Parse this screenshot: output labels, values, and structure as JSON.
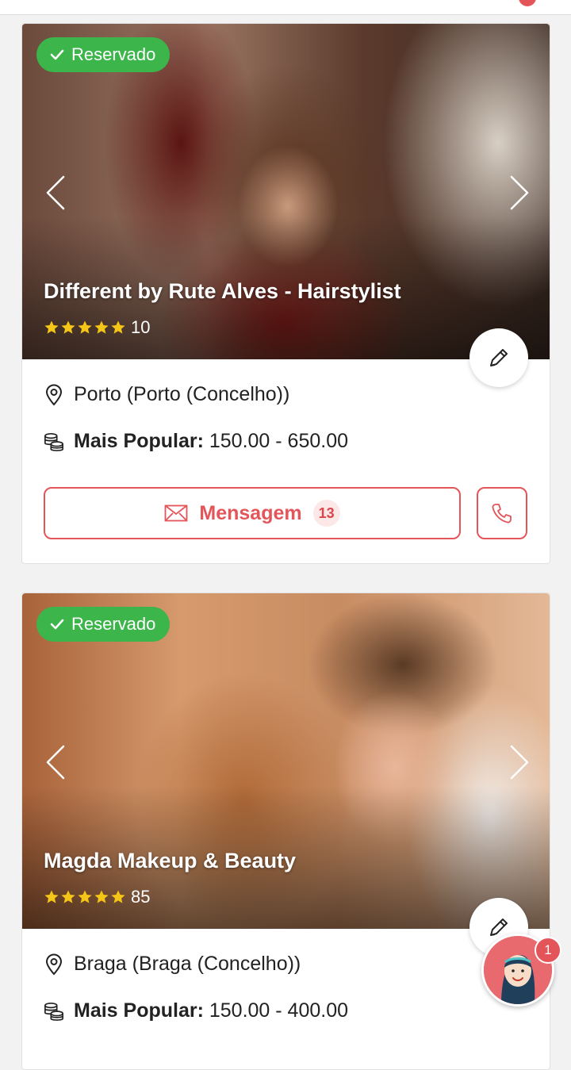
{
  "colors": {
    "accent": "#e4555a",
    "badge_green": "#3cb54a",
    "star": "#f5c518"
  },
  "vendors": [
    {
      "badge": "Reservado",
      "name": "Different by Rute Alves - Hairstylist",
      "rating_stars": 5,
      "review_count": "10",
      "location": "Porto (Porto (Concelho))",
      "price_label": "Mais Popular:",
      "price_value": "150.00 - 650.00",
      "message_label": "Mensagem",
      "message_count": "13"
    },
    {
      "badge": "Reservado",
      "name": "Magda Makeup & Beauty",
      "rating_stars": 5,
      "review_count": "85",
      "location": "Braga (Braga (Concelho))",
      "price_label": "Mais Popular:",
      "price_value": "150.00 - 400.00"
    }
  ],
  "icons": [
    "check-icon",
    "chevron-left-icon",
    "chevron-right-icon",
    "star-icon",
    "pencil-icon",
    "location-pin-icon",
    "coins-icon",
    "envelope-icon",
    "phone-icon"
  ],
  "chat": {
    "unread": "1"
  }
}
